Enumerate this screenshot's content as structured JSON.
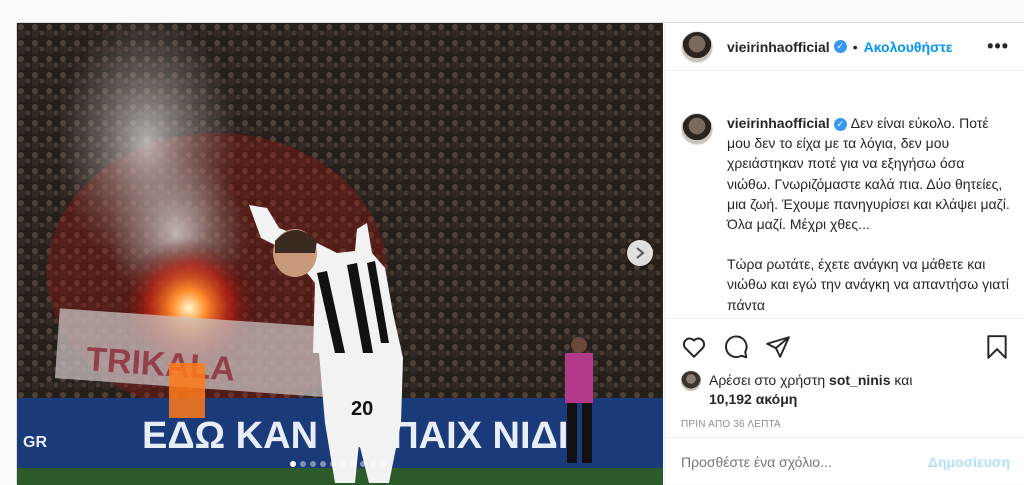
{
  "header": {
    "username": "vieirinhaofficial",
    "separator": "•",
    "follow_label": "Ακολουθήστε",
    "more_label": "•••"
  },
  "caption": {
    "username": "vieirinhaofficial",
    "paragraph1": "Δεν είναι εύκολο. Ποτέ μου δεν το είχα με τα λόγια, δεν μου χρειάστηκαν ποτέ για να εξηγήσω όσα νιώθω. Γνωριζόμαστε καλά πια. Δύο θητείες, μια ζωή. Έχουμε πανηγυρίσει και κλάψει μαζί. Όλα μαζί. Μέχρι χθες...",
    "paragraph2": "Τώρα ρωτάτε, έχετε ανάγκη να μάθετε και νιώθω και εγώ την ανάγκη να απαντήσω γιατί πάντα"
  },
  "photo": {
    "banner_text": "ΕΔΩ ΚΑΝ     ΤΟ ΠΑΙΧ  ΝΙΔΙ",
    "jersey_number": "20",
    "corner_text": "GR",
    "fan_banner": "TRIKALA"
  },
  "carousel": {
    "count": 10,
    "active_index": 0
  },
  "likes": {
    "prefix": "Αρέσει στο χρήστη",
    "user": "sot_ninis",
    "conj": "και",
    "others": "10,192 ακόμη"
  },
  "timestamp": "ΠΡΙΝ ΑΠΟ 36 ΛΕΠΤΑ",
  "comment": {
    "placeholder": "Προσθέστε ένα σχόλιο...",
    "post_label": "Δημοσίευση"
  },
  "colors": {
    "accent": "#0095f6",
    "post_disabled": "#b2dffc",
    "verified": "#3897f0"
  }
}
